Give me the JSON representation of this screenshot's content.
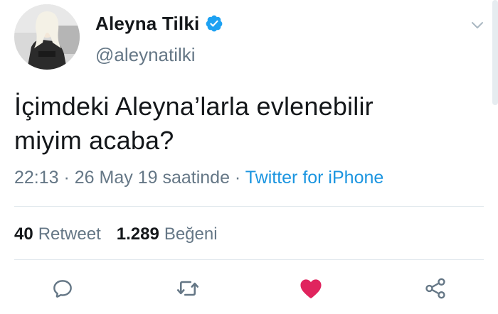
{
  "user": {
    "display_name": "Aleyna Tilki",
    "handle": "@aleynatilki",
    "verified_icon": "verified-badge-icon"
  },
  "tweet": {
    "text_line1": "İçimdeki Aleyna’larla evlenebilir",
    "text_line2": "miyim acaba?",
    "time": "22:13",
    "separator1": " · ",
    "date": "26 May 19 saatinde",
    "separator2": " · ",
    "source": "Twitter for iPhone"
  },
  "stats": {
    "retweet_count": "40",
    "retweet_label": "Retweet",
    "like_count": "1.289",
    "like_label": "Beğeni"
  },
  "actions": {
    "reply_icon": "reply-icon",
    "retweet_icon": "retweet-icon",
    "like_icon": "heart-icon",
    "share_icon": "share-icon",
    "like_color": "#e0245e",
    "icon_color": "#657786"
  },
  "colors": {
    "link": "#1b95e0",
    "verified": "#1da1f2",
    "text": "#14171a",
    "muted": "#657786"
  }
}
